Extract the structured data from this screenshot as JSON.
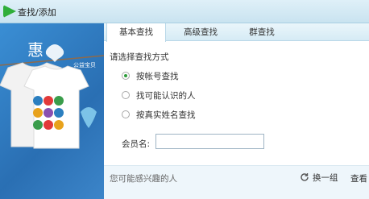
{
  "window": {
    "title": "查找/添加"
  },
  "sidebar": {
    "charity_badge": "公益宝贝"
  },
  "tabs": [
    {
      "label": "基本查找",
      "active": true
    },
    {
      "label": "高级查找",
      "active": false
    },
    {
      "label": "群查找",
      "active": false
    }
  ],
  "search": {
    "section_title": "请选择查找方式",
    "options": [
      {
        "label": "按帐号查找",
        "checked": true
      },
      {
        "label": "找可能认识的人",
        "checked": false
      },
      {
        "label": "按真实姓名查找",
        "checked": false
      }
    ],
    "member_label": "会员名:",
    "member_value": ""
  },
  "bottom": {
    "interest_label": "您可能感兴趣的人",
    "refresh_label": "换一组",
    "view_label": "查看"
  },
  "colors": {
    "radio_checked": "#2e9c3a",
    "sidebar_bg": "#2f7fc4",
    "titlebar": "#c9e3f0"
  }
}
